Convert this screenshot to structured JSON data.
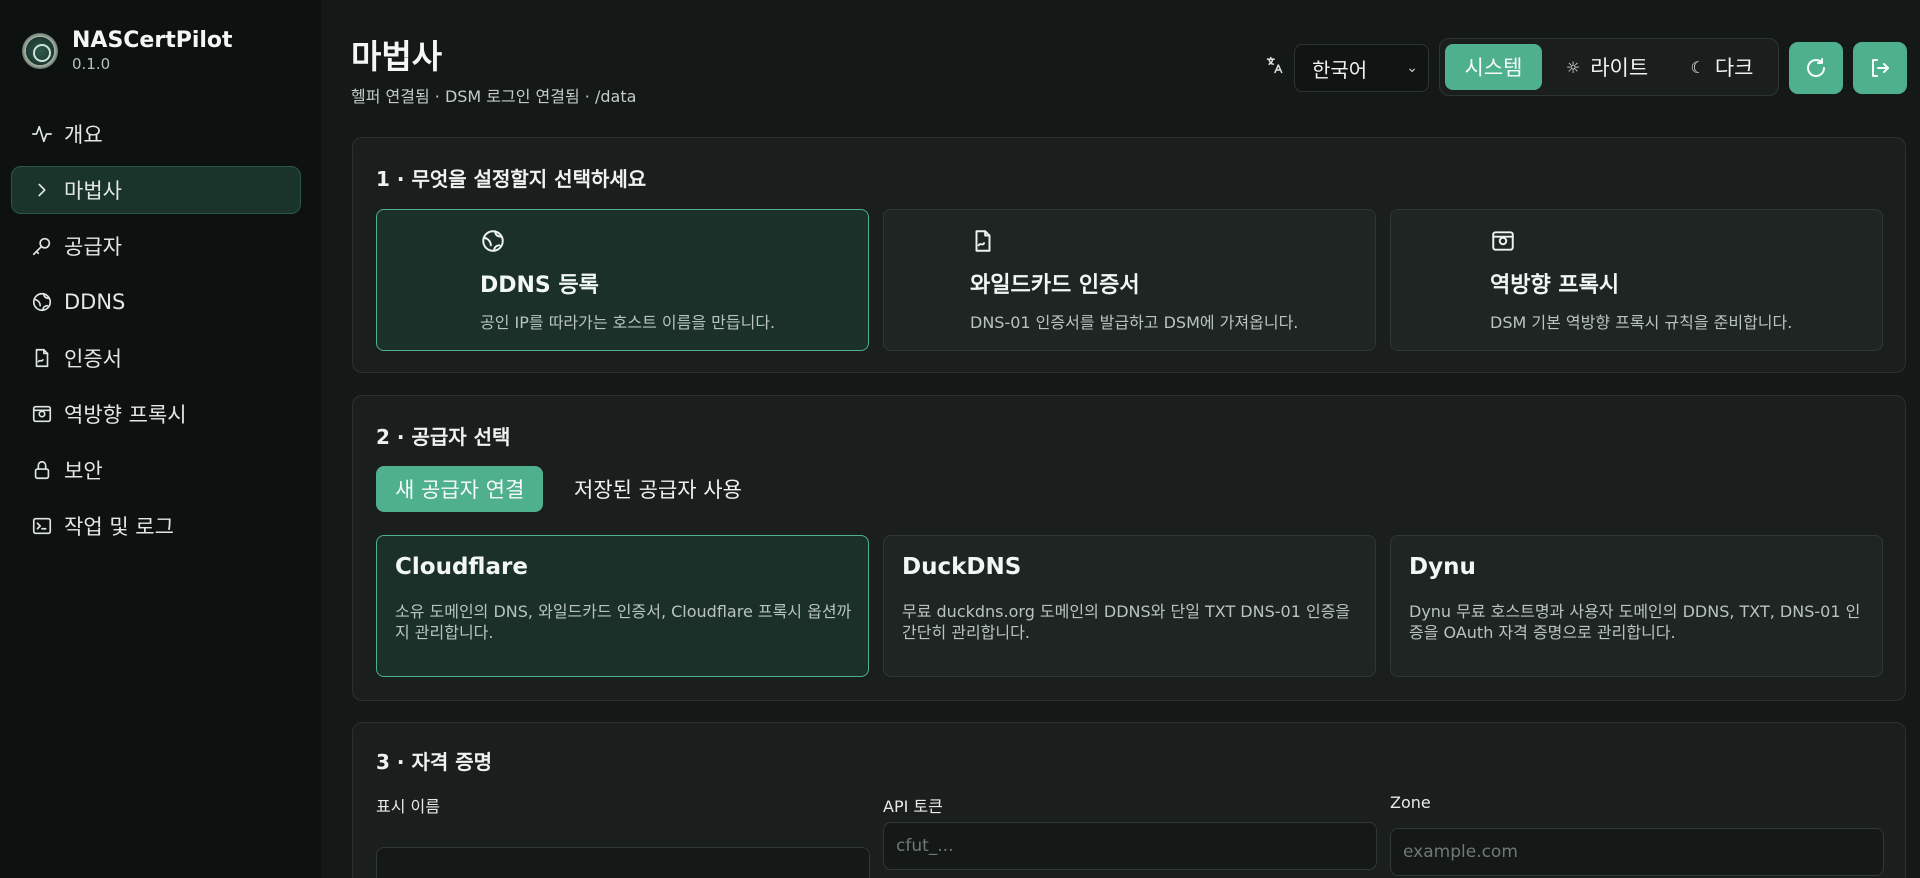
{
  "app": {
    "name": "NASCertPilot",
    "version": "0.1.0"
  },
  "sidebar": {
    "items": [
      {
        "label": "개요",
        "icon": "activity-icon"
      },
      {
        "label": "마법사",
        "icon": "chevron-right-icon",
        "active": true
      },
      {
        "label": "공급자",
        "icon": "key-icon"
      },
      {
        "label": "DDNS",
        "icon": "globe-icon"
      },
      {
        "label": "인증서",
        "icon": "file-signature-icon"
      },
      {
        "label": "역방향 프록시",
        "icon": "proxy-icon"
      },
      {
        "label": "보안",
        "icon": "lock-icon"
      },
      {
        "label": "작업 및 로그",
        "icon": "terminal-icon"
      }
    ]
  },
  "header": {
    "title": "마법사",
    "subtitle": "헬퍼 연결됨 · DSM 로그인 연결됨 · /data",
    "language": "한국어",
    "theme": {
      "system": "시스템",
      "light": "라이트",
      "dark": "다크",
      "selected": "system"
    }
  },
  "step1": {
    "title": "1 · 무엇을 설정할지 선택하세요",
    "options": [
      {
        "title": "DDNS 등록",
        "desc": "공인 IP를 따라가는 호스트 이름을 만듭니다.",
        "icon": "globe-icon",
        "selected": true
      },
      {
        "title": "와일드카드 인증서",
        "desc": "DNS-01 인증서를 발급하고 DSM에 가져옵니다.",
        "icon": "file-signature-icon"
      },
      {
        "title": "역방향 프록시",
        "desc": "DSM 기본 역방향 프록시 규칙을 준비합니다.",
        "icon": "proxy-icon"
      }
    ]
  },
  "step2": {
    "title": "2 · 공급자 선택",
    "tabs": [
      "새 공급자 연결",
      "저장된 공급자 사용"
    ],
    "providers": [
      {
        "name": "Cloudflare",
        "desc": "소유 도메인의 DNS, 와일드카드 인증서, Cloudflare 프록시 옵션까지 관리합니다.",
        "selected": true
      },
      {
        "name": "DuckDNS",
        "desc": "무료 duckdns.org 도메인의 DDNS와 단일 TXT DNS-01 인증을 간단히 관리합니다."
      },
      {
        "name": "Dynu",
        "desc": "Dynu 무료 호스트명과 사용자 도메인의 DDNS, TXT, DNS-01 인증을 OAuth 자격 증명으로 관리합니다."
      }
    ]
  },
  "step3": {
    "title": "3 · 자격 증명",
    "fields": [
      {
        "label": "표시 이름",
        "placeholder": ""
      },
      {
        "label": "API 토큰",
        "placeholder": "cfut_..."
      },
      {
        "label": "Zone",
        "placeholder": "example.com"
      }
    ]
  },
  "colors": {
    "accent": "#4fb08e",
    "background": "#141816",
    "sidebar": "#0d1110"
  }
}
